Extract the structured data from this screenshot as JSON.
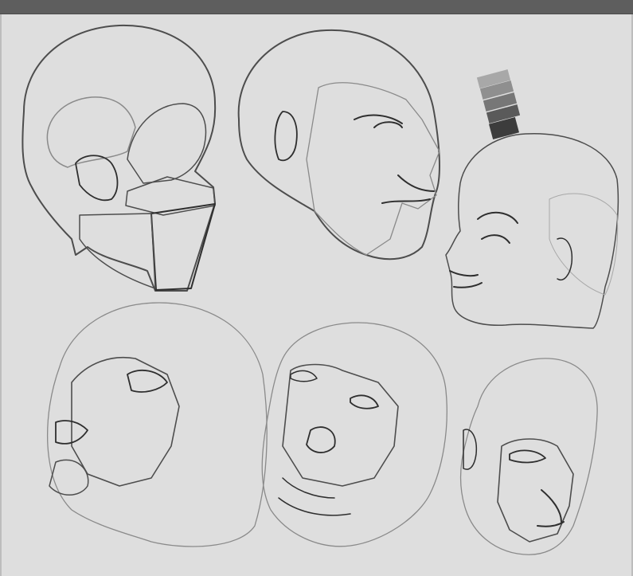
{
  "colors": {
    "titlebar": "#5e5e5e",
    "canvas": "#dedede",
    "swatches": [
      "#a8a8a8",
      "#8f8f8f",
      "#777777",
      "#5a5a5a",
      "#3c3c3c"
    ]
  },
  "sketches": [
    {
      "name": "skull-planes-study",
      "icon": "head-sketch-icon"
    },
    {
      "name": "bald-head-three-quarter-rendered",
      "icon": "head-sketch-icon"
    },
    {
      "name": "head-profile-rendered",
      "icon": "head-sketch-icon"
    },
    {
      "name": "head-tilted-up-sketch",
      "icon": "head-sketch-icon"
    },
    {
      "name": "head-tilted-sketch-center",
      "icon": "head-sketch-icon"
    },
    {
      "name": "head-looking-down-sketch",
      "icon": "head-sketch-icon"
    }
  ]
}
